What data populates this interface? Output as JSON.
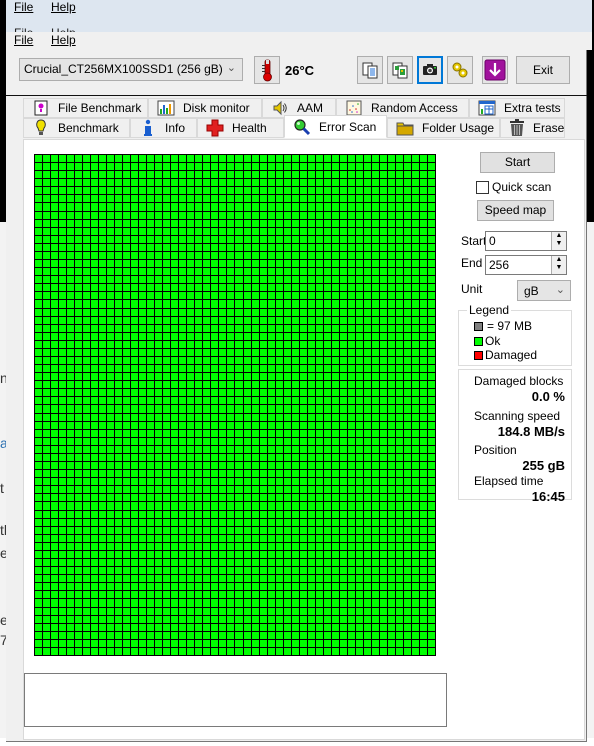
{
  "menu": {
    "file": "File",
    "help": "Help"
  },
  "toolbar": {
    "drive": "Crucial_CT256MX100SSD1 (256 gB)",
    "temperature": "26°C",
    "exit_label": "Exit",
    "buttons": [
      "copy-text-icon",
      "copy-image-icon",
      "screenshot-camera-icon",
      "options-icon",
      "download-icon"
    ]
  },
  "tabs": {
    "row1": [
      {
        "label": "File Benchmark",
        "icon": "file-benchmark-icon"
      },
      {
        "label": "Disk monitor",
        "icon": "disk-monitor-icon"
      },
      {
        "label": "AAM",
        "icon": "speaker-icon"
      },
      {
        "label": "Random Access",
        "icon": "random-access-icon"
      },
      {
        "label": "Extra tests",
        "icon": "extra-tests-icon"
      }
    ],
    "row2": [
      {
        "label": "Benchmark",
        "icon": "benchmark-icon"
      },
      {
        "label": "Info",
        "icon": "info-icon"
      },
      {
        "label": "Health",
        "icon": "health-cross-icon"
      },
      {
        "label": "Error Scan",
        "icon": "magnifier-icon",
        "selected": true
      },
      {
        "label": "Folder Usage",
        "icon": "folder-icon"
      },
      {
        "label": "Erase",
        "icon": "trash-icon"
      }
    ]
  },
  "error_scan": {
    "start_button": "Start",
    "quick_scan_label": "Quick scan",
    "quick_scan_checked": false,
    "speed_map_button": "Speed map",
    "start_label": "Start",
    "start_value": "0",
    "end_label": "End",
    "end_value": "256",
    "unit_label": "Unit",
    "unit_value": "gB",
    "legend": {
      "title": "Legend",
      "block_size": "= 97 MB",
      "ok": "Ok",
      "damaged": "Damaged",
      "colors": {
        "block": "#808080",
        "ok": "#00ff00",
        "damaged": "#ff0000"
      }
    },
    "stats": {
      "damaged_blocks_label": "Damaged blocks",
      "damaged_blocks_value": "0.0 %",
      "scanning_speed_label": "Scanning speed",
      "scanning_speed_value": "184.8 MB/s",
      "position_label": "Position",
      "position_value": "255 gB",
      "elapsed_label": "Elapsed time",
      "elapsed_value": "16:45"
    },
    "block_grid": {
      "status": "all ok",
      "ok_color": "#00ff00"
    },
    "log_text": ""
  },
  "background_window": {
    "text_fragments": [
      "nr",
      "a",
      "t ;",
      "th",
      "ea",
      "e",
      "7"
    ]
  }
}
